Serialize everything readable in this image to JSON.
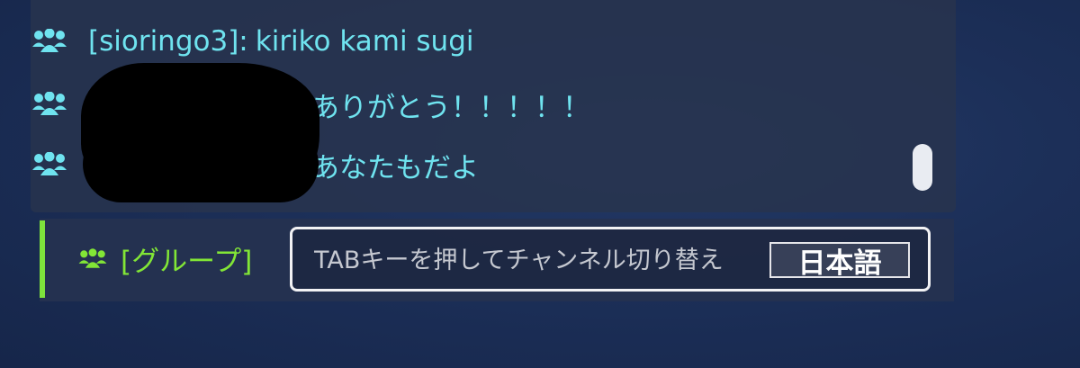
{
  "chat": {
    "messages": [
      {
        "speaker": "[sioringo3]:",
        "text": "kiriko kami sugi"
      },
      {
        "speaker": "",
        "text": "ありがとう！！！！！"
      },
      {
        "speaker": "",
        "text": "あなたもだよ"
      }
    ]
  },
  "input": {
    "channel_label": "[グループ]",
    "placeholder": "TABキーを押してチャンネル切り替え",
    "ime_mode": "日本語"
  },
  "colors": {
    "chat_text": "#6fe3ef",
    "channel_green": "#82e636",
    "accent_bar": "#7ee33c"
  },
  "icons": {
    "group": "group-icon"
  }
}
